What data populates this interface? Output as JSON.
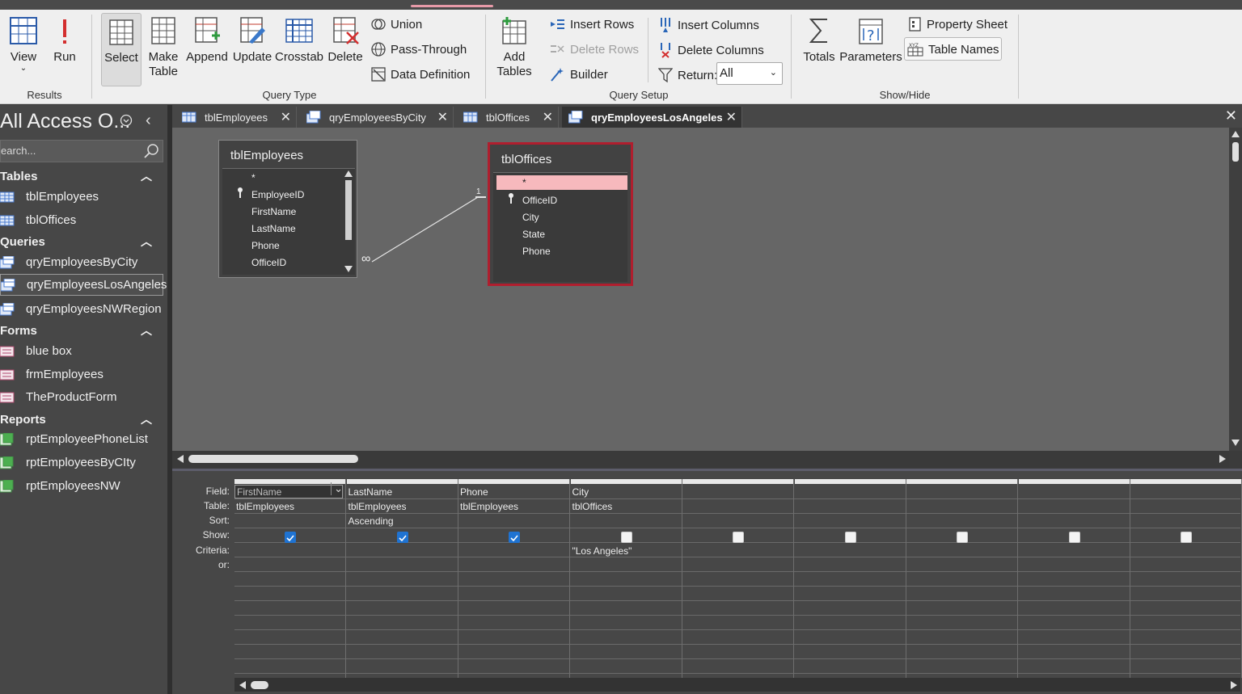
{
  "ribbon": {
    "results": {
      "label": "Results",
      "view": "View",
      "run": "Run"
    },
    "query_type": {
      "label": "Query Type",
      "select": "Select",
      "make_table": "Make Table",
      "make_table_l1": "Make",
      "make_table_l2": "Table",
      "append": "Append",
      "update": "Update",
      "crosstab": "Crosstab",
      "delete": "Delete",
      "union": "Union",
      "pass_through": "Pass-Through",
      "data_definition": "Data Definition"
    },
    "query_setup": {
      "label": "Query Setup",
      "add_tables_l1": "Add",
      "add_tables_l2": "Tables",
      "insert_rows": "Insert Rows",
      "delete_rows": "Delete Rows",
      "builder": "Builder",
      "insert_columns": "Insert Columns",
      "delete_columns": "Delete Columns",
      "return_label": "Return:",
      "return_value": "All"
    },
    "show_hide": {
      "label": "Show/Hide",
      "totals": "Totals",
      "parameters": "Parameters",
      "property_sheet": "Property Sheet",
      "table_names": "Table Names"
    }
  },
  "nav": {
    "title": "All Access O...",
    "search_placeholder": "earch...",
    "groups": [
      {
        "label": "Tables",
        "items": [
          "tblEmployees",
          "tblOffices"
        ]
      },
      {
        "label": "Queries",
        "items": [
          "qryEmployeesByCity",
          "qryEmployeesLosAngeles",
          "qryEmployeesNWRegion"
        ]
      },
      {
        "label": "Forms",
        "items": [
          "blue box",
          "frmEmployees",
          "TheProductForm"
        ]
      },
      {
        "label": "Reports",
        "items": [
          "rptEmployeePhoneList",
          "rptEmployeesByCIty",
          "rptEmployeesNW"
        ]
      }
    ]
  },
  "tabs": [
    "tblEmployees",
    "qryEmployeesByCity",
    "tblOffices",
    "qryEmployeesLosAngeles"
  ],
  "design": {
    "employees_table": {
      "title": "tblEmployees",
      "fields": [
        "*",
        "EmployeeID",
        "FirstName",
        "LastName",
        "Phone",
        "OfficeID"
      ]
    },
    "offices_table": {
      "title": "tblOffices",
      "fields": [
        "*",
        "OfficeID",
        "City",
        "State",
        "Phone"
      ]
    },
    "relationship": {
      "one_label": "1",
      "many_label": "∞"
    }
  },
  "grid": {
    "row_labels": [
      "Field:",
      "Table:",
      "Sort:",
      "Show:",
      "Criteria:",
      "or:"
    ],
    "columns": [
      {
        "field": "FirstName",
        "table": "tblEmployees",
        "sort": "",
        "show": true,
        "criteria": ""
      },
      {
        "field": "LastName",
        "table": "tblEmployees",
        "sort": "Ascending",
        "show": true,
        "criteria": ""
      },
      {
        "field": "Phone",
        "table": "tblEmployees",
        "sort": "",
        "show": true,
        "criteria": ""
      },
      {
        "field": "City",
        "table": "tblOffices",
        "sort": "",
        "show": false,
        "criteria": "\"Los Angeles\""
      },
      {
        "field": "",
        "table": "",
        "sort": "",
        "show": false,
        "criteria": ""
      },
      {
        "field": "",
        "table": "",
        "sort": "",
        "show": false,
        "criteria": ""
      },
      {
        "field": "",
        "table": "",
        "sort": "",
        "show": false,
        "criteria": ""
      },
      {
        "field": "",
        "table": "",
        "sort": "",
        "show": false,
        "criteria": ""
      },
      {
        "field": "",
        "table": "",
        "sort": "",
        "show": false,
        "criteria": ""
      }
    ]
  },
  "colors": {
    "accent": "#1f73d2",
    "selected_table_border": "#b01e2e",
    "selected_field_bg": "#f7b9bd"
  }
}
